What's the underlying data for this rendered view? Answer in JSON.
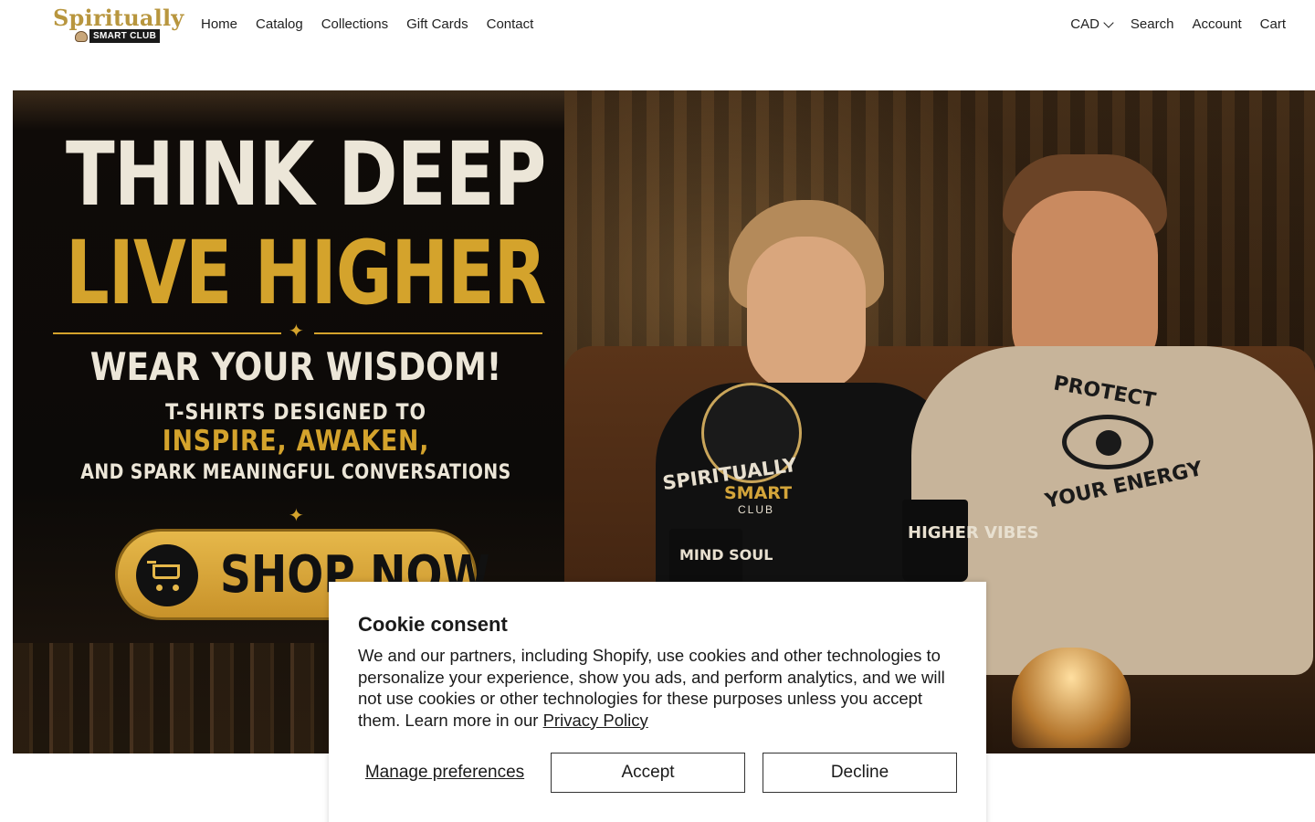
{
  "brand": {
    "logo_title": "Spiritually",
    "logo_subtitle": "SMART CLUB"
  },
  "nav": {
    "items": [
      "Home",
      "Catalog",
      "Collections",
      "Gift Cards",
      "Contact"
    ]
  },
  "utility": {
    "currency": "CAD",
    "search": "Search",
    "account": "Account",
    "cart": "Cart"
  },
  "hero": {
    "headline_1": "THINK DEEP",
    "headline_2": "LIVE HIGHER",
    "tagline": "WEAR YOUR WISDOM!",
    "sub_1": "T-SHIRTS DESIGNED TO",
    "sub_2": "INSPIRE, AWAKEN,",
    "sub_3": "AND SPARK MEANINGFUL CONVERSATIONS",
    "cta": "SHOP NOW",
    "shirt_left_1": "SPIRITUALLY",
    "shirt_left_2": "SMART",
    "shirt_left_3": "CLUB",
    "shirt_right_top": "PROTECT",
    "shirt_right_bottom": "YOUR ENERGY",
    "mug_left": "MIND SOUL",
    "mug_right": "HIGHER VIBES"
  },
  "cookie": {
    "title": "Cookie consent",
    "body": "We and our partners, including Shopify, use cookies and other technologies to personalize your experience, show you ads, and perform analytics, and we will not use cookies or other technologies for these purposes unless you accept them. Learn more in our ",
    "link": "Privacy Policy",
    "manage": "Manage preferences",
    "accept": "Accept",
    "decline": "Decline"
  },
  "colors": {
    "gold": "#d4a32c",
    "cream": "#ece6d8",
    "dark": "#111111"
  },
  "icons": {
    "currency_dropdown": "chevron-down-icon",
    "cta": "shopping-cart-icon"
  }
}
